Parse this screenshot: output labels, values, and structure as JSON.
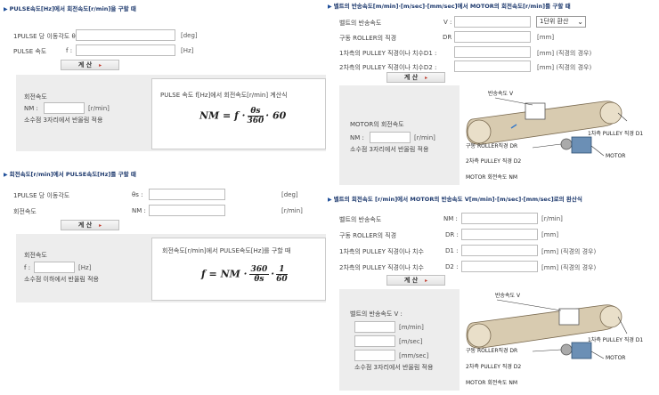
{
  "sec1": {
    "title": "PULSE속도[Hz]에서 회전속도[r/min]을 구할 때",
    "row1_label": "1PULSE 당 이동각도 θs :",
    "row1_unit": "[deg]",
    "row2_label": "PULSE 속도",
    "row2_sym": "f :",
    "row2_unit": "[Hz]",
    "calc": "계 산",
    "result_title": "회전속도",
    "result_sym": "NM :",
    "result_unit": "[r/min]",
    "result_note": "소수점 3자리에서 반올림 적용",
    "formula_title": "PULSE 속도 f[Hz]에서 회전속도[r/min] 계산식",
    "formula_lhs": "NM = f ·",
    "formula_num": "θs",
    "formula_den": "360",
    "formula_rhs": "· 60"
  },
  "sec2": {
    "title": "회전속도[r/min]에서 PULSE속도[Hz]를 구할 때",
    "row1_label": "1PULSE 당 이동각도",
    "row1_sym": "θs :",
    "row1_unit": "[deg]",
    "row2_label": "회전속도",
    "row2_sym": "NM :",
    "row2_unit": "[r/min]",
    "calc": "계 산",
    "result_title": "회전속도",
    "result_sym": "f :",
    "result_unit": "[Hz]",
    "result_note": "소수점 이하에서 반올림 적용",
    "formula_title": "회전속도[r/min]에서 PULSE속도[Hz]를 구할 때",
    "formula_lhs": "f = NM ·",
    "formula_num1": "360",
    "formula_den1": "θs",
    "formula_num2": "1",
    "formula_den2": "60"
  },
  "sec3": {
    "title": "벨트의 반송속도[m/min]·[m/sec]·[mm/sec]에서 MOTOR의 회전속도[r/min]를 구할 때",
    "row1_label": "벨트의 반송속도",
    "row1_sym": "V :",
    "row1_select": "1단위 환산",
    "row2_label": "구동 ROLLER의 직경",
    "row2_sym": "DR :",
    "row2_unit": "[mm]",
    "row3_label": "1차측의 PULLEY 직경이나 치수D1 :",
    "row3_unit": "[mm] (직경의 경우)",
    "row4_label": "2차측의 PULLEY 직경이나 치수D2 :",
    "row4_unit": "[mm] (직경의 경우)",
    "calc": "계 산",
    "result_title": "MOTOR의 회전속도",
    "result_sym": "NM :",
    "result_unit": "[r/min]",
    "result_note": "소수점 3자리에서 반올림 적용",
    "diagram": {
      "speed": "반송속도 V",
      "d1": "1차측 PULLEY 직경 D1",
      "roller": "구동 ROLLER직경 DR",
      "d2": "2차측 PULLEY 직경 D2",
      "motor": "MOTOR",
      "nm": "MOTOR 회전속도 NM"
    }
  },
  "sec4": {
    "title": "벨트의 회전속도 [r/min]에서 MOTOR의 반송속도 V[m/min]·[m/sec]·[mm/sec]로의 환산식",
    "row1_label": "벨트의 반송속도",
    "row1_sym": "NM :",
    "row1_unit": "[r/min]",
    "row2_label": "구동 ROLLER의 직경",
    "row2_sym": "DR :",
    "row2_unit": "[mm]",
    "row3_label": "1차측의 PULLEY 직경이나 치수",
    "row3_sym": "D1 :",
    "row3_unit": "[mm] (직경의 경우)",
    "row4_label": "2차측의 PULLEY 직경이나 치수",
    "row4_sym": "D2 :",
    "row4_unit": "[mm] (직경의 경우)",
    "calc": "계 산",
    "result_title": "벨트의 반송속도 V :",
    "unit1": "[m/min]",
    "unit2": "[m/sec]",
    "unit3": "[mm/sec]",
    "result_note": "소수점 3자리에서 반올림 적용",
    "diagram": {
      "speed": "반송속도 V",
      "d1": "1차측 PULLEY 직경 D1",
      "roller": "구동 ROLLER직경 DR",
      "d2": "2차측 PULLEY 직경 D2",
      "motor": "MOTOR",
      "nm": "MOTOR 회전속도 NM"
    }
  },
  "colors": {
    "title": "#1e3a6e",
    "panel": "#ededed",
    "calc_arrow": "#c0392b",
    "belt": "#d8cbb0",
    "motor": "#6b8fb5"
  }
}
